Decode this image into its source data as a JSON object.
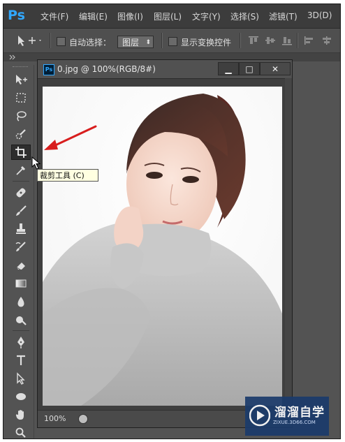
{
  "app": {
    "logo": "Ps"
  },
  "menu": [
    "文件(F)",
    "编辑(E)",
    "图像(I)",
    "图层(L)",
    "文字(Y)",
    "选择(S)",
    "滤镜(T)",
    "3D(D)"
  ],
  "options": {
    "auto_select_label": "自动选择：",
    "auto_select_value": "图层",
    "show_transform_label": "显示变换控件"
  },
  "document": {
    "title": "0.jpg @ 100%(RGB/8#)",
    "zoom": "100%",
    "min_label": "▁",
    "max_label": "□",
    "close_label": "✕"
  },
  "tooltip": {
    "text": "裁剪工具 (C)"
  },
  "toolbox": {
    "tools": [
      "move-tool",
      "marquee-tool",
      "lasso-tool",
      "quick-select-tool",
      "crop-tool",
      "eyedropper-tool",
      "healing-brush-tool",
      "brush-tool",
      "clone-stamp-tool",
      "history-brush-tool",
      "eraser-tool",
      "gradient-tool",
      "blur-tool",
      "dodge-tool",
      "pen-tool",
      "type-tool",
      "path-select-tool",
      "ellipse-tool",
      "hand-tool",
      "zoom-tool"
    ],
    "active": "crop-tool"
  },
  "watermark": {
    "title": "溜溜自学",
    "sub": "ZIXUE.3D66.COM"
  },
  "colors": {
    "accent": "#31a8ff",
    "arrow": "#d81e1e",
    "panel": "#535353"
  }
}
